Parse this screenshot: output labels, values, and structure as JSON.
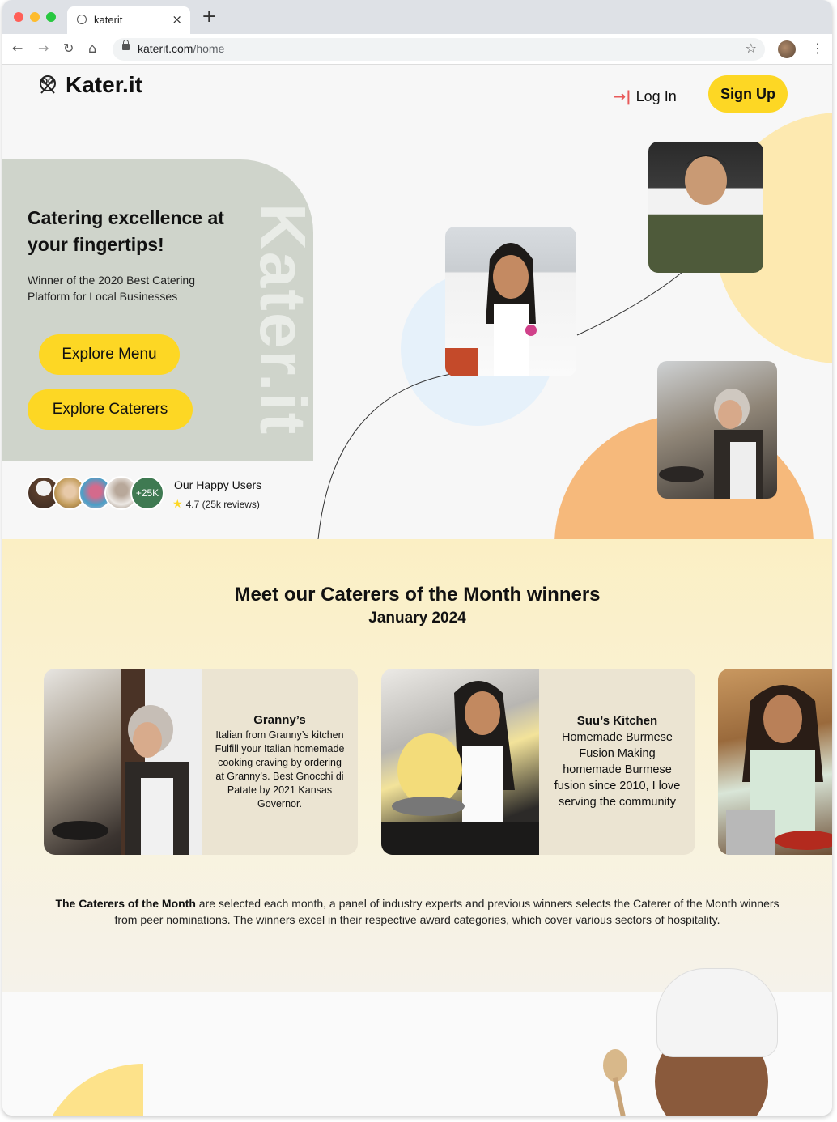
{
  "browser": {
    "tab_title": "katerit",
    "tab_close": "×",
    "new_tab": "+",
    "url_host": "katerit.com",
    "url_path": "/home",
    "icons": [
      "back-icon",
      "forward-icon",
      "reload-icon",
      "home-icon",
      "lock-icon",
      "star-icon",
      "profile-avatar",
      "menu-kebab-icon"
    ]
  },
  "header": {
    "logo_text": "Kater.it",
    "login_label": "Log In",
    "login_icon": "→|",
    "signup_label": "Sign Up"
  },
  "hero": {
    "vertical_brand": "Kater.it",
    "title": "Catering excellence at your fingertips!",
    "subtitle": "Winner of the 2020 Best Catering Platform for Local Businesses",
    "explore_menu": "Explore Menu",
    "explore_caterers": "Explore Caterers",
    "users_count": "+25K",
    "users_title": "Our Happy Users",
    "users_rating": "4.7 (25k reviews)",
    "rating_star": "★"
  },
  "caterers": {
    "title": "Meet our Caterers of the Month winners",
    "month": "January 2024",
    "cards": [
      {
        "name": "Granny’s",
        "description": "Italian from Granny’s kitchen Fulfill your Italian homemade cooking craving by ordering at Granny’s. Best Gnocchi di Patate by 2021 Kansas Governor."
      },
      {
        "name": "Suu’s Kitchen",
        "description": "Homemade Burmese Fusion Making homemade Burmese fusion since 2010, I love serving the community"
      }
    ],
    "note_bold": "The Caterers of the Month",
    "note_rest": " are selected each month, a panel of industry experts and previous winners selects the Caterer of the Month winners from peer nominations. The winners excel in their respective award categories, which cover various sectors of hospitality."
  },
  "colors": {
    "accent_yellow": "#fdd724",
    "hero_card": "#cfd4cb",
    "orange": "#f6b97b",
    "light_blue": "#e6f1fa",
    "green_badge": "#3f7a52"
  }
}
